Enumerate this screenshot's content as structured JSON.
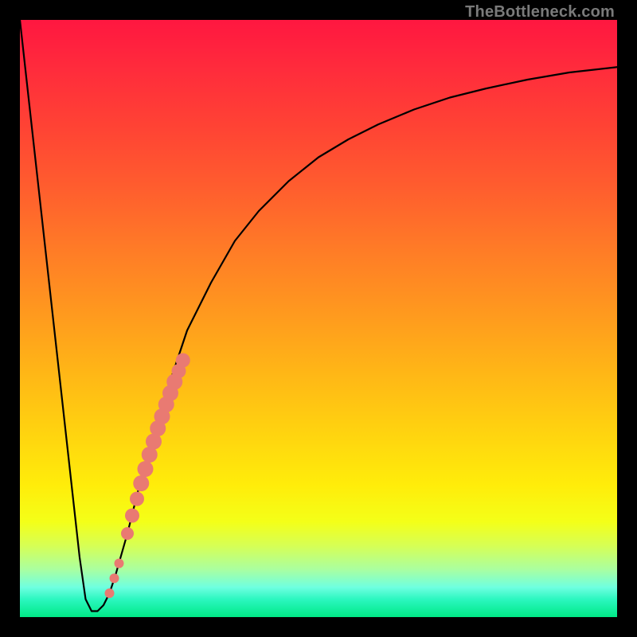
{
  "watermark": "TheBottleneck.com",
  "colors": {
    "frame": "#000000",
    "curve": "#000000",
    "marker": "#e97a72",
    "gradient_top": "#ff1740",
    "gradient_bottom": "#00e986"
  },
  "chart_data": {
    "type": "line",
    "title": "",
    "xlabel": "",
    "ylabel": "",
    "xlim": [
      0,
      100
    ],
    "ylim": [
      0,
      100
    ],
    "grid": false,
    "legend": false,
    "annotations": [
      "TheBottleneck.com"
    ],
    "series": [
      {
        "name": "bottleneck-curve",
        "x": [
          0,
          4,
          8,
          10,
          11,
          12,
          13,
          14,
          15,
          16,
          18,
          20,
          22,
          25,
          28,
          32,
          36,
          40,
          45,
          50,
          55,
          60,
          66,
          72,
          78,
          85,
          92,
          100
        ],
        "y": [
          100,
          64,
          28,
          10,
          3,
          1,
          1,
          2,
          4,
          7,
          14,
          22,
          29,
          39,
          48,
          56,
          63,
          68,
          73,
          77,
          80,
          82.5,
          85,
          87,
          88.5,
          90,
          91.2,
          92.1
        ]
      }
    ],
    "markers": {
      "name": "highlight-dots",
      "x": [
        15.0,
        15.8,
        16.6,
        18.0,
        18.8,
        19.6,
        20.3,
        21.0,
        21.7,
        22.4,
        23.1,
        23.8,
        24.5,
        25.2,
        25.9,
        26.6,
        27.3
      ],
      "y": [
        4.0,
        6.5,
        9.0,
        14.0,
        17.0,
        19.8,
        22.4,
        24.8,
        27.2,
        29.4,
        31.6,
        33.6,
        35.6,
        37.5,
        39.4,
        41.2,
        43.0
      ],
      "r": [
        6,
        6,
        6,
        8,
        9,
        9,
        10,
        10,
        10,
        10,
        10,
        10,
        10,
        10,
        10,
        9,
        9
      ]
    }
  }
}
